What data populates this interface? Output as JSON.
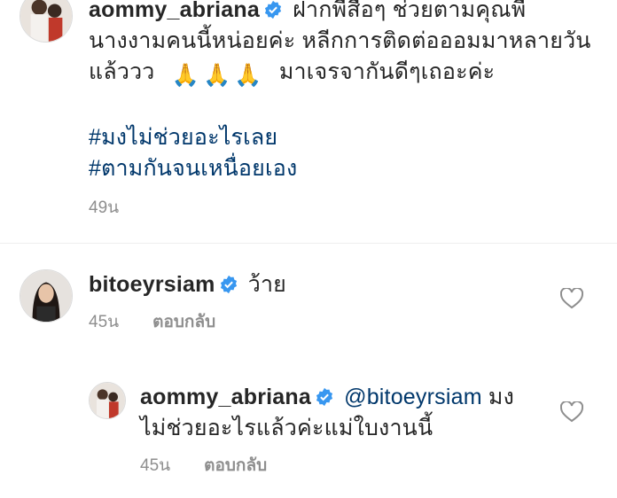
{
  "caption": {
    "username": "aommy_abriana",
    "text_lines": [
      "ฝากพี่สื่อๆ ช่วยตามคุณพี่",
      "นางงามคนนี้หน่อยค่ะ หลีกการติดต่อออมมาหลายวัน",
      "แล้ววว",
      "มาเจรจากันดีๆเถอะค่ะ"
    ],
    "emoji": [
      "🙏",
      "🙏",
      "🙏"
    ],
    "hashtags": [
      "#มงไม่ช่วยอะไรเลย",
      "#ตามกันจนเหนื่อยเอง"
    ],
    "time": "49น"
  },
  "comment1": {
    "username": "bitoeyrsiam",
    "text": "ว้าย",
    "time": "45น",
    "reply_label": "ตอบกลับ"
  },
  "reply1": {
    "username": "aommy_abriana",
    "mention": "@bitoeyrsiam",
    "text_first": "มง",
    "text_second": "ไม่ช่วยอะไรแล้วค่ะแม่ใบงานนี้",
    "time": "45น",
    "reply_label": "ตอบกลับ"
  },
  "colors": {
    "verified_blue": "#3897f0",
    "link_blue": "#00376b",
    "meta_gray": "#8e8e8e"
  }
}
